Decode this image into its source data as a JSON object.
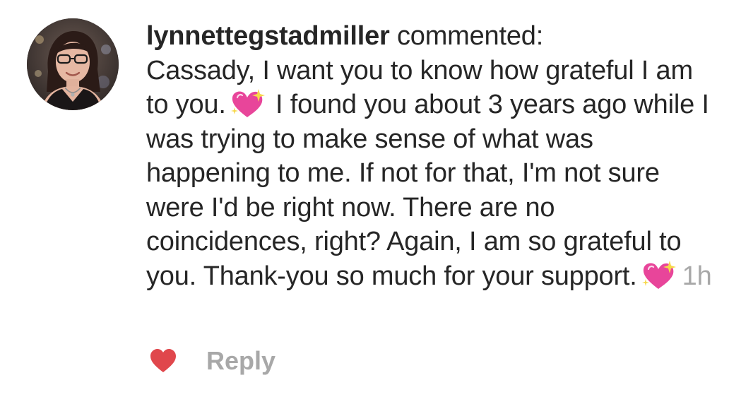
{
  "comment": {
    "username": "lynnettegstadmiller",
    "action_text": " commented:",
    "text_part1": "Cassady, I want you to know how grateful I am to you.",
    "emoji_1": "sparkling-heart-icon",
    "text_part2": "I found you about 3 years ago while I was trying to make sense of what was happening to me. If not for that, I'm not sure were I'd be right now. There are no coincidences, right? Again, I am so grateful to you. Thank-you so much for your support.",
    "emoji_2": "sparkling-heart-icon",
    "timestamp": "1h"
  },
  "actions": {
    "like_icon": "heart-icon",
    "reply_label": "Reply"
  },
  "colors": {
    "text": "#262626",
    "muted": "#a8a8a8",
    "heart": "#e0474c",
    "emoji_heart": "#e8459a"
  }
}
